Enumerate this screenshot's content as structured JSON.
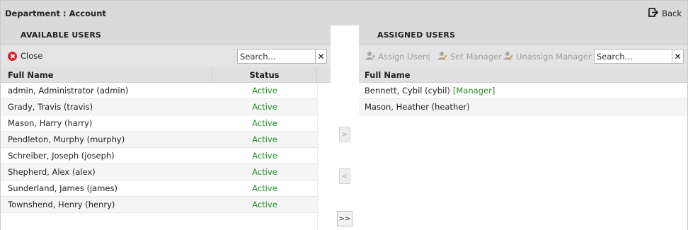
{
  "header": {
    "title": "Department : Account",
    "back_label": "Back"
  },
  "available": {
    "section_title": "AVAILABLE USERS",
    "close_label": "Close",
    "search_placeholder": "Search...",
    "clear_symbol": "✕",
    "columns": {
      "name": "Full Name",
      "status": "Status"
    },
    "rows": [
      {
        "name": "admin, Administrator (admin)",
        "status": "Active"
      },
      {
        "name": "Grady, Travis (travis)",
        "status": "Active"
      },
      {
        "name": "Mason, Harry (harry)",
        "status": "Active"
      },
      {
        "name": "Pendleton, Murphy (murphy)",
        "status": "Active"
      },
      {
        "name": "Schreiber, Joseph (joseph)",
        "status": "Active"
      },
      {
        "name": "Shepherd, Alex (alex)",
        "status": "Active"
      },
      {
        "name": "Sunderland, James (james)",
        "status": "Active"
      },
      {
        "name": "Townshend, Henry (henry)",
        "status": "Active"
      }
    ]
  },
  "transfer": {
    "add_label": ">",
    "remove_label": "<",
    "add_all_label": ">>"
  },
  "assigned": {
    "section_title": "ASSIGNED USERS",
    "assign_label": "Assign Users",
    "set_manager_label": "Set Manager",
    "unassign_manager_label": "Unassign Manager",
    "search_placeholder": "Search...",
    "clear_symbol": "✕",
    "columns": {
      "name": "Full Name"
    },
    "rows": [
      {
        "name": "Bennett, Cybil (cybil)",
        "tag": "[Manager]"
      },
      {
        "name": "Mason, Heather (heather)",
        "tag": ""
      }
    ]
  },
  "colors": {
    "active_green": "#2d8a2d",
    "close_red": "#d9262b",
    "disabled_gray": "#9d9d9d"
  },
  "icons": {
    "back": "exit-arrow-icon",
    "close": "close-circle-icon",
    "assign": "user-add-icon",
    "set_manager": "user-edit-icon",
    "unassign_manager": "user-remove-icon"
  }
}
